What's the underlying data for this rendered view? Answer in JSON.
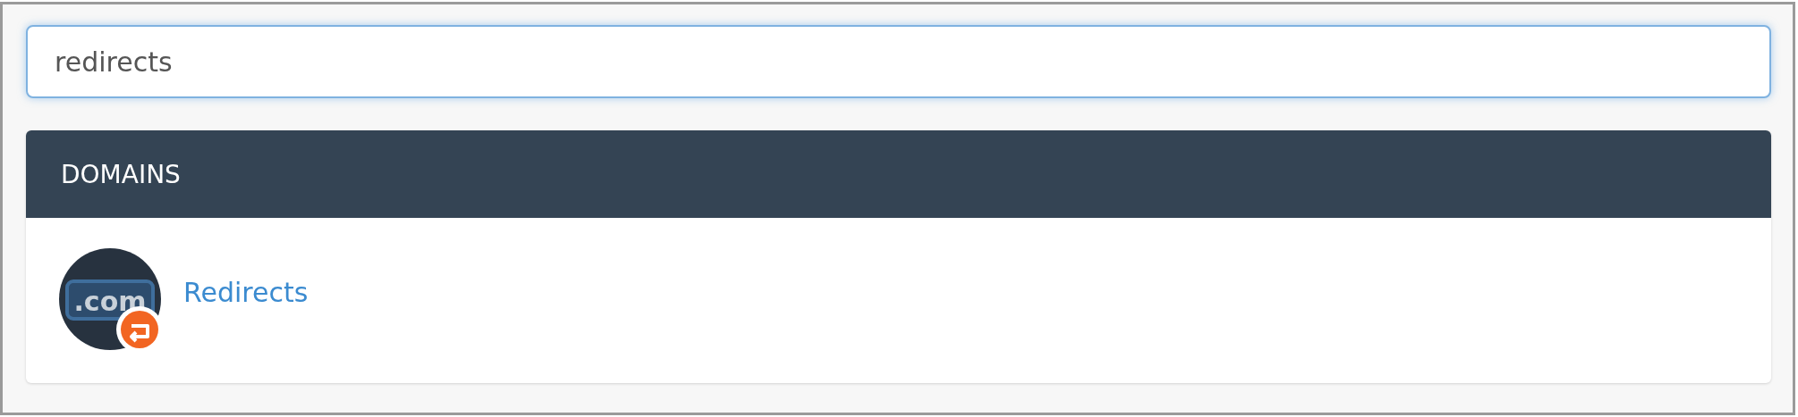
{
  "search": {
    "value": "redirects",
    "focused": true
  },
  "results": [
    {
      "heading": "DOMAINS",
      "items": [
        {
          "label": "Redirects",
          "icon_text": ".com"
        }
      ]
    }
  ]
}
